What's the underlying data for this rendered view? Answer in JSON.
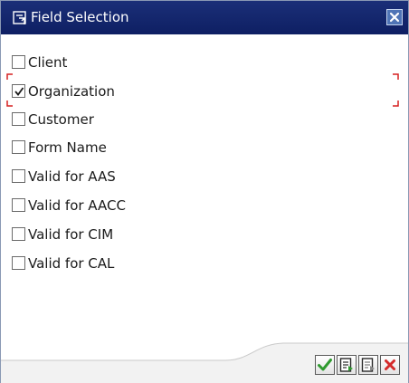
{
  "window": {
    "title": "Field Selection",
    "title_icon": "field-selection-icon",
    "close_icon": "close-icon"
  },
  "fields": [
    {
      "label": "Client",
      "checked": false
    },
    {
      "label": "Organization",
      "checked": true
    },
    {
      "label": "Customer",
      "checked": false
    },
    {
      "label": "Form Name",
      "checked": false
    },
    {
      "label": "Valid for AAS",
      "checked": false
    },
    {
      "label": "Valid for AACC",
      "checked": false
    },
    {
      "label": "Valid for CIM",
      "checked": false
    },
    {
      "label": "Valid for CAL",
      "checked": false
    }
  ],
  "toolbar": {
    "buttons": [
      {
        "name": "confirm-button",
        "icon": "checkmark-icon"
      },
      {
        "name": "select-all-button",
        "icon": "select-all-icon"
      },
      {
        "name": "deselect-all-button",
        "icon": "deselect-all-icon"
      },
      {
        "name": "cancel-button",
        "icon": "cancel-icon"
      }
    ]
  },
  "colors": {
    "title_bar": "#14286e",
    "focus_marker": "#d62020",
    "confirm_green": "#2f9a2f",
    "cancel_red": "#d42a2a"
  }
}
